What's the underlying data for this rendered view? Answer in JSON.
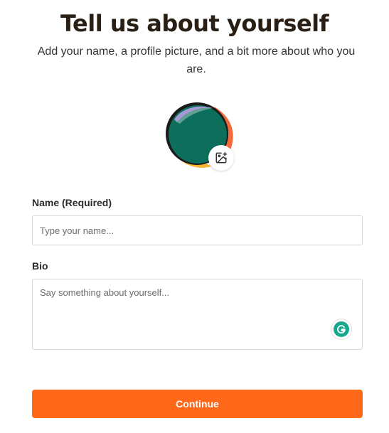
{
  "header": {
    "title": "Tell us about yourself",
    "subtitle": "Add your name, a profile picture, and a bit more about who you are."
  },
  "avatar": {
    "icon": "avatar-image",
    "upload_icon": "image-upload-icon",
    "colors": {
      "main": "#0d6e5b",
      "outline": "#1a1a1a",
      "accent_purple": "#a49bd6",
      "accent_orange": "#f26b3a",
      "accent_yellow": "#f6b32b"
    }
  },
  "form": {
    "name": {
      "label": "Name (Required)",
      "placeholder": "Type your name...",
      "value": ""
    },
    "bio": {
      "label": "Bio",
      "placeholder": "Say something about yourself...",
      "value": "",
      "assistant_icon": "grammarly-icon"
    }
  },
  "actions": {
    "continue_label": "Continue"
  },
  "colors": {
    "accent": "#ff6719",
    "grammarly": "#15a88c"
  }
}
